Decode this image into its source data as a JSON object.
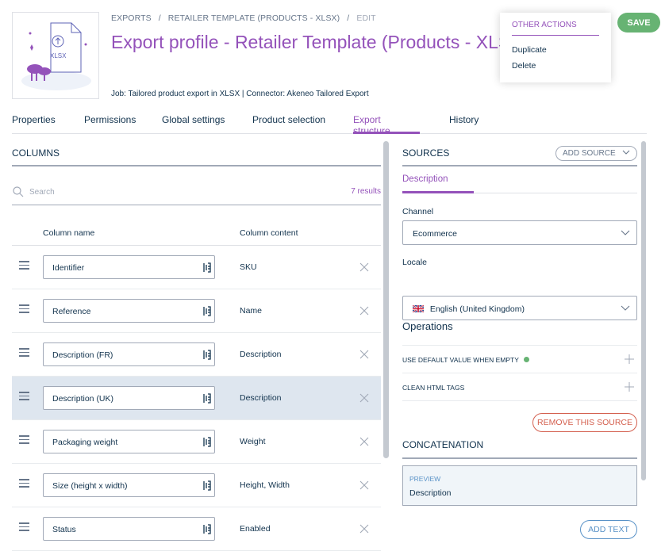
{
  "breadcrumb": {
    "exports": "EXPORTS",
    "sep1": "/",
    "template": "RETAILER TEMPLATE (PRODUCTS - XLSX)",
    "sep2": "/",
    "edit": "EDIT"
  },
  "title": "Export profile - Retailer Template (Products - XLSX)",
  "illustration_label": "XLSX",
  "job_info": "Job: Tailored product export in XLSX | Connector: Akeneo Tailored Export",
  "actions_menu": {
    "title": "OTHER ACTIONS",
    "items": [
      "Duplicate",
      "Delete"
    ]
  },
  "save_label": "SAVE",
  "tabs": [
    {
      "label": "Properties",
      "active": false
    },
    {
      "label": "Permissions",
      "active": false
    },
    {
      "label": "Global settings",
      "active": false
    },
    {
      "label": "Product selection",
      "active": false
    },
    {
      "label": "Export structure",
      "active": true
    },
    {
      "label": "History",
      "active": false
    }
  ],
  "columns": {
    "title": "COLUMNS",
    "search_placeholder": "Search",
    "results": "7 results",
    "header_name": "Column name",
    "header_content": "Column content",
    "rows": [
      {
        "name": "Identifier",
        "content": "SKU",
        "selected": false
      },
      {
        "name": "Reference",
        "content": "Name",
        "selected": false
      },
      {
        "name": "Description (FR)",
        "content": "Description",
        "selected": false
      },
      {
        "name": "Description (UK)",
        "content": "Description",
        "selected": true
      },
      {
        "name": "Packaging weight",
        "content": "Weight",
        "selected": false
      },
      {
        "name": "Size (height x width)",
        "content": "Height, Width",
        "selected": false
      },
      {
        "name": "Status",
        "content": "Enabled",
        "selected": false
      }
    ]
  },
  "sources": {
    "title": "SOURCES",
    "add_source": "ADD SOURCE",
    "active_source": "Description",
    "channel_label": "Channel",
    "channel_value": "Ecommerce",
    "locale_label": "Locale",
    "locale_value": "English (United Kingdom)",
    "operations_title": "Operations",
    "operations": [
      {
        "label": "USE DEFAULT VALUE WHEN EMPTY",
        "active": true
      },
      {
        "label": "CLEAN HTML TAGS",
        "active": false
      }
    ],
    "remove_source": "REMOVE THIS SOURCE"
  },
  "concatenation": {
    "title": "CONCATENATION",
    "preview_label": "PREVIEW",
    "preview_value": "Description",
    "add_text": "ADD TEXT"
  },
  "colors": {
    "accent": "#9452ba",
    "save": "#67b373",
    "danger": "#d4604f",
    "blue": "#5992c7",
    "text": "#11324d"
  }
}
